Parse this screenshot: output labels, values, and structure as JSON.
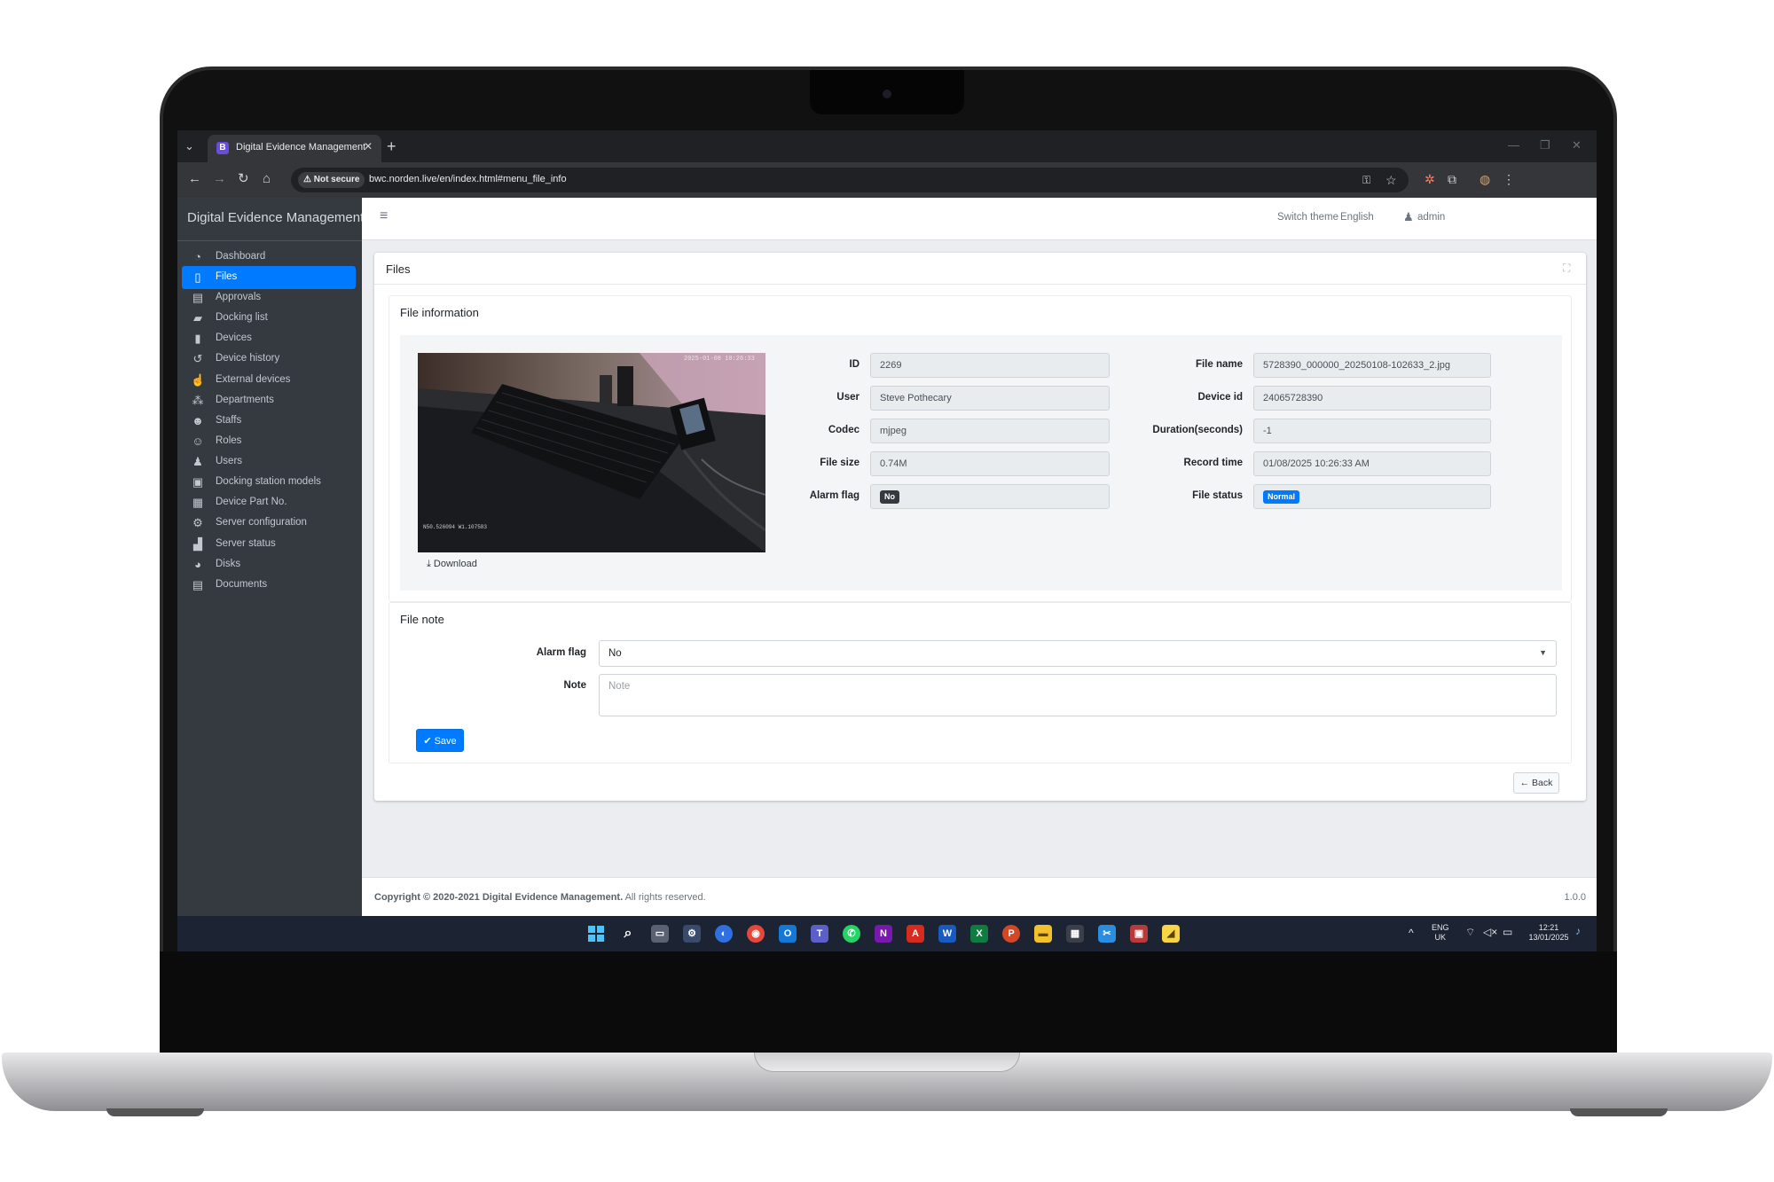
{
  "browser": {
    "tab_title": "Digital Evidence Management",
    "favicon_letter": "B",
    "not_secure": "⚠ Not secure",
    "url": "bwc.norden.live/en/index.html#menu_file_info"
  },
  "app": {
    "brand": "Digital Evidence Management",
    "topnav": {
      "switch_theme": "Switch theme",
      "language": "English",
      "user": "admin"
    },
    "sidebar": {
      "items": [
        {
          "label": "Dashboard",
          "icon": "dashboard-icon",
          "glyph": "◔"
        },
        {
          "label": "Files",
          "icon": "file-icon",
          "glyph": "▯"
        },
        {
          "label": "Approvals",
          "icon": "approvals-icon",
          "glyph": "▤"
        },
        {
          "label": "Docking list",
          "icon": "docking-icon",
          "glyph": "▰"
        },
        {
          "label": "Devices",
          "icon": "device-icon",
          "glyph": "▮"
        },
        {
          "label": "Device history",
          "icon": "history-icon",
          "glyph": "↺"
        },
        {
          "label": "External devices",
          "icon": "hand-icon",
          "glyph": "☝"
        },
        {
          "label": "Departments",
          "icon": "departments-icon",
          "glyph": "⁂"
        },
        {
          "label": "Staffs",
          "icon": "staffs-icon",
          "glyph": "☻"
        },
        {
          "label": "Roles",
          "icon": "roles-icon",
          "glyph": "☺"
        },
        {
          "label": "Users",
          "icon": "users-icon",
          "glyph": "♟"
        },
        {
          "label": "Docking station models",
          "icon": "save-icon",
          "glyph": "▣"
        },
        {
          "label": "Device Part No.",
          "icon": "document-icon",
          "glyph": "▦"
        },
        {
          "label": "Server configuration",
          "icon": "gears-icon",
          "glyph": "⚙"
        },
        {
          "label": "Server status",
          "icon": "chart-icon",
          "glyph": "▟"
        },
        {
          "label": "Disks",
          "icon": "pie-icon",
          "glyph": "◕"
        },
        {
          "label": "Documents",
          "icon": "documents-icon",
          "glyph": "▤"
        }
      ]
    },
    "files_title": "Files",
    "file_info": {
      "title": "File information",
      "download": "Download",
      "thumb_overlay_top": "2025-01-08 10:26:33",
      "thumb_overlay_bottom": "N50.526094 W1.107583",
      "labels": {
        "id": "ID",
        "user": "User",
        "codec": "Codec",
        "file_size": "File size",
        "alarm_flag": "Alarm flag",
        "file_name": "File name",
        "device_id": "Device id",
        "duration": "Duration(seconds)",
        "record_time": "Record time",
        "file_status": "File status"
      },
      "values": {
        "id": "2269",
        "user": "Steve Pothecary",
        "codec": "mjpeg",
        "file_size": "0.74M",
        "alarm_flag": "No",
        "file_name": "5728390_000000_20250108-102633_2.jpg",
        "device_id": "24065728390",
        "duration": "-1",
        "record_time": "01/08/2025 10:26:33 AM",
        "file_status": "Normal"
      }
    },
    "file_note": {
      "title": "File note",
      "alarm_flag_label": "Alarm flag",
      "alarm_flag_value": "No",
      "note_label": "Note",
      "note_placeholder": "Note",
      "save": "Save"
    },
    "back": "Back",
    "footer": {
      "copyright_bold": "Copyright © 2020-2021 Digital Evidence Management.",
      "copyright_rest": " All rights reserved.",
      "version": "1.0.0"
    }
  },
  "taskbar": {
    "lang_top": "ENG",
    "lang_bottom": "UK",
    "time": "12:21",
    "date": "13/01/2025"
  },
  "colors": {
    "accent": "#007bff",
    "sidebar_bg": "#343a40"
  }
}
